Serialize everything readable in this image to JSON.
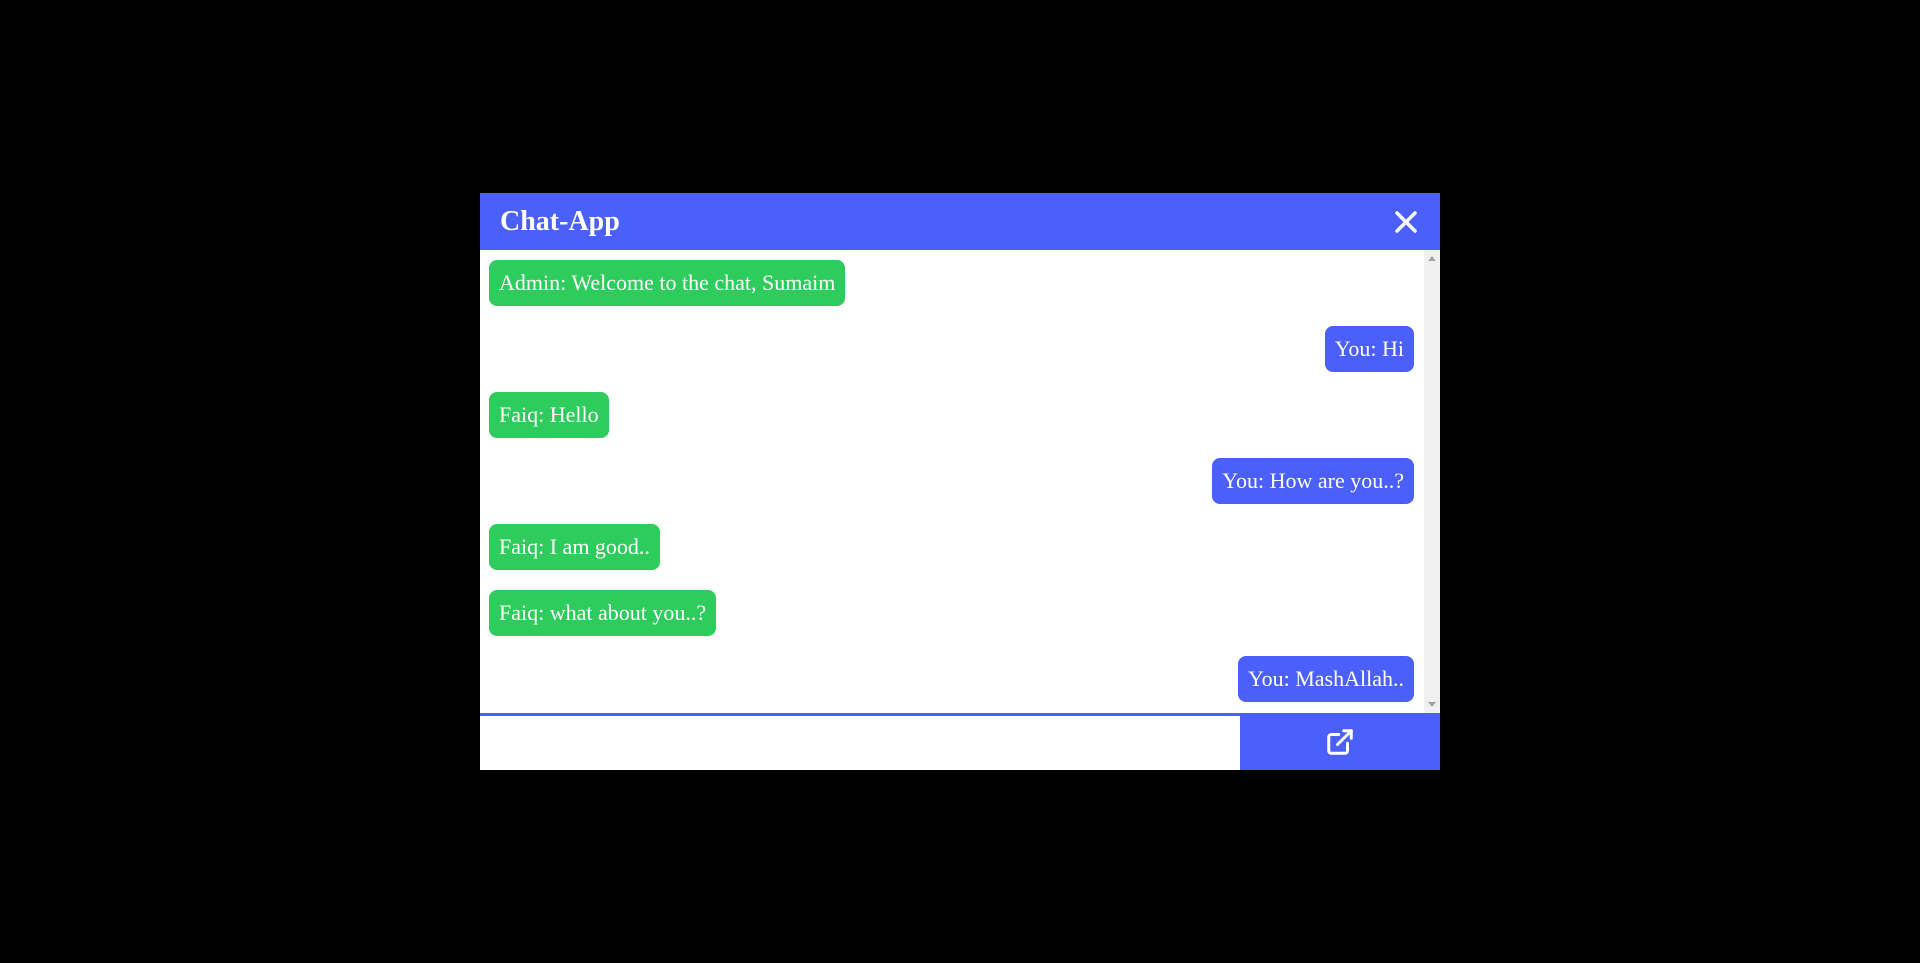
{
  "app": {
    "title": "Chat-App"
  },
  "header": {
    "close_icon": "close-icon"
  },
  "messages": [
    {
      "side": "left",
      "color": "green",
      "text": "Admin: Welcome to the chat, Sumaim"
    },
    {
      "side": "right",
      "color": "blue",
      "text": "You: Hi"
    },
    {
      "side": "left",
      "color": "green",
      "text": "Faiq: Hello"
    },
    {
      "side": "right",
      "color": "blue",
      "text": "You: How are you..?"
    },
    {
      "side": "left",
      "color": "green",
      "text": "Faiq: I am good.."
    },
    {
      "side": "left",
      "color": "green",
      "text": "Faiq: what about you..?"
    },
    {
      "side": "right",
      "color": "blue",
      "text": "You: MashAllah.."
    }
  ],
  "composer": {
    "input_value": "",
    "placeholder": "",
    "send_icon": "external-link-icon"
  },
  "colors": {
    "accent": "#4a5ffb",
    "incoming_bubble": "#2ecc5c",
    "background": "#000000"
  }
}
